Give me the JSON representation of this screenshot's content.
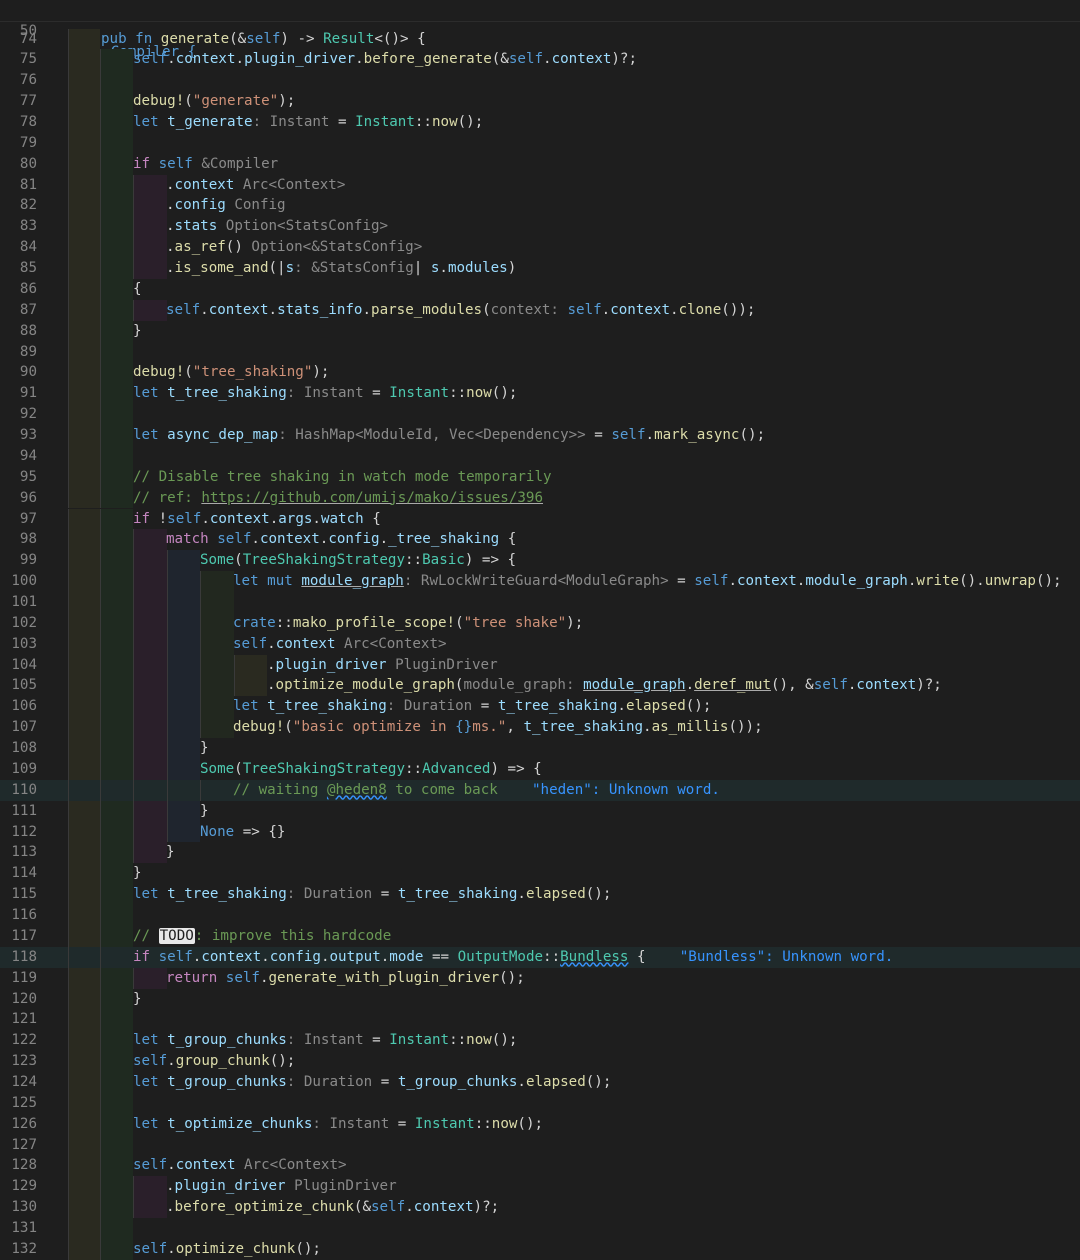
{
  "sticky_header": {
    "line_number": "50",
    "text": "impl Compiler {"
  },
  "lines": [
    {
      "n": "74",
      "g": 1,
      "tokens": [
        [
          "k",
          "pub "
        ],
        [
          "k",
          "fn "
        ],
        [
          "f",
          "generate"
        ],
        [
          "d",
          "(&"
        ],
        [
          "k",
          "self"
        ],
        [
          "d",
          ") -> "
        ],
        [
          "t",
          "Result"
        ],
        [
          "d",
          "<()> "
        ],
        [
          "d",
          "{"
        ]
      ]
    },
    {
      "n": "75",
      "g": 2,
      "tokens": [
        [
          "k",
          "self"
        ],
        [
          "d",
          "."
        ],
        [
          "v",
          "context"
        ],
        [
          "d",
          "."
        ],
        [
          "v",
          "plugin_driver"
        ],
        [
          "d",
          "."
        ],
        [
          "f",
          "before_generate"
        ],
        [
          "d",
          "(&"
        ],
        [
          "k",
          "self"
        ],
        [
          "d",
          "."
        ],
        [
          "v",
          "context"
        ],
        [
          "d",
          ")?;"
        ]
      ]
    },
    {
      "n": "76",
      "g": 2,
      "tokens": []
    },
    {
      "n": "77",
      "g": 2,
      "tokens": [
        [
          "f",
          "debug!"
        ],
        [
          "d",
          "("
        ],
        [
          "s",
          "\"generate\""
        ],
        [
          "d",
          ");"
        ]
      ]
    },
    {
      "n": "78",
      "g": 2,
      "tokens": [
        [
          "k",
          "let "
        ],
        [
          "v",
          "t_generate"
        ],
        [
          "h",
          ": Instant"
        ],
        [
          "d",
          " = "
        ],
        [
          "t",
          "Instant"
        ],
        [
          "d",
          "::"
        ],
        [
          "f",
          "now"
        ],
        [
          "d",
          "();"
        ]
      ]
    },
    {
      "n": "79",
      "g": 2,
      "tokens": []
    },
    {
      "n": "80",
      "g": 2,
      "tokens": [
        [
          "kc",
          "if "
        ],
        [
          "k",
          "self"
        ],
        [
          "h",
          " &Compiler"
        ]
      ]
    },
    {
      "n": "81",
      "g": 3,
      "tokens": [
        [
          "d",
          "."
        ],
        [
          "v",
          "context"
        ],
        [
          "h",
          " Arc<Context>"
        ]
      ]
    },
    {
      "n": "82",
      "g": 3,
      "tokens": [
        [
          "d",
          "."
        ],
        [
          "v",
          "config"
        ],
        [
          "h",
          " Config"
        ]
      ]
    },
    {
      "n": "83",
      "g": 3,
      "tokens": [
        [
          "d",
          "."
        ],
        [
          "v",
          "stats"
        ],
        [
          "h",
          " Option<StatsConfig>"
        ]
      ]
    },
    {
      "n": "84",
      "g": 3,
      "tokens": [
        [
          "d",
          "."
        ],
        [
          "f",
          "as_ref"
        ],
        [
          "d",
          "()"
        ],
        [
          "h",
          " Option<&StatsConfig>"
        ]
      ]
    },
    {
      "n": "85",
      "g": 3,
      "tokens": [
        [
          "d",
          "."
        ],
        [
          "f",
          "is_some_and"
        ],
        [
          "d",
          "(|"
        ],
        [
          "v",
          "s"
        ],
        [
          "h",
          ": &StatsConfig"
        ],
        [
          "d",
          "| "
        ],
        [
          "v",
          "s"
        ],
        [
          "d",
          "."
        ],
        [
          "v",
          "modules"
        ],
        [
          "d",
          ")"
        ]
      ]
    },
    {
      "n": "86",
      "g": 2,
      "tokens": [
        [
          "d",
          "{"
        ]
      ]
    },
    {
      "n": "87",
      "g": 3,
      "tokens": [
        [
          "k",
          "self"
        ],
        [
          "d",
          "."
        ],
        [
          "v",
          "context"
        ],
        [
          "d",
          "."
        ],
        [
          "v",
          "stats_info"
        ],
        [
          "d",
          "."
        ],
        [
          "f",
          "parse_modules"
        ],
        [
          "d",
          "("
        ],
        [
          "h",
          "context: "
        ],
        [
          "k",
          "self"
        ],
        [
          "d",
          "."
        ],
        [
          "v",
          "context"
        ],
        [
          "d",
          "."
        ],
        [
          "f",
          "clone"
        ],
        [
          "d",
          "());"
        ]
      ]
    },
    {
      "n": "88",
      "g": 2,
      "tokens": [
        [
          "d",
          "}"
        ]
      ]
    },
    {
      "n": "89",
      "g": 2,
      "tokens": []
    },
    {
      "n": "90",
      "g": 2,
      "tokens": [
        [
          "f",
          "debug!"
        ],
        [
          "d",
          "("
        ],
        [
          "s",
          "\"tree_shaking\""
        ],
        [
          "d",
          ");"
        ]
      ]
    },
    {
      "n": "91",
      "g": 2,
      "tokens": [
        [
          "k",
          "let "
        ],
        [
          "v",
          "t_tree_shaking"
        ],
        [
          "h",
          ": Instant"
        ],
        [
          "d",
          " = "
        ],
        [
          "t",
          "Instant"
        ],
        [
          "d",
          "::"
        ],
        [
          "f",
          "now"
        ],
        [
          "d",
          "();"
        ]
      ]
    },
    {
      "n": "92",
      "g": 2,
      "tokens": []
    },
    {
      "n": "93",
      "g": 2,
      "tokens": [
        [
          "k",
          "let "
        ],
        [
          "v",
          "async_dep_map"
        ],
        [
          "h",
          ": HashMap<ModuleId, Vec<Dependency>>"
        ],
        [
          "d",
          " = "
        ],
        [
          "k",
          "self"
        ],
        [
          "d",
          "."
        ],
        [
          "f",
          "mark_async"
        ],
        [
          "d",
          "();"
        ]
      ]
    },
    {
      "n": "94",
      "g": 2,
      "tokens": []
    },
    {
      "n": "95",
      "g": 2,
      "tokens": [
        [
          "c",
          "// Disable tree shaking in watch mode temporarily"
        ]
      ]
    },
    {
      "n": "96",
      "g": 2,
      "tokens": [
        [
          "c",
          "// ref: "
        ],
        [
          "cu",
          "https://github.com/umijs/mako/issues/396"
        ]
      ]
    },
    {
      "n": "97",
      "g": 2,
      "tokens": [
        [
          "kc",
          "if "
        ],
        [
          "d",
          "!"
        ],
        [
          "k",
          "self"
        ],
        [
          "d",
          "."
        ],
        [
          "v",
          "context"
        ],
        [
          "d",
          "."
        ],
        [
          "v",
          "args"
        ],
        [
          "d",
          "."
        ],
        [
          "v",
          "watch"
        ],
        [
          "d",
          " {"
        ]
      ]
    },
    {
      "n": "98",
      "g": 3,
      "tokens": [
        [
          "kc",
          "match "
        ],
        [
          "k",
          "self"
        ],
        [
          "d",
          "."
        ],
        [
          "v",
          "context"
        ],
        [
          "d",
          "."
        ],
        [
          "v",
          "config"
        ],
        [
          "d",
          "."
        ],
        [
          "v",
          "_tree_shaking"
        ],
        [
          "d",
          " {"
        ]
      ]
    },
    {
      "n": "99",
      "g": 4,
      "tokens": [
        [
          "t",
          "Some"
        ],
        [
          "d",
          "("
        ],
        [
          "t",
          "TreeShakingStrategy"
        ],
        [
          "d",
          "::"
        ],
        [
          "t",
          "Basic"
        ],
        [
          "d",
          ") => {"
        ]
      ]
    },
    {
      "n": "100",
      "g": 5,
      "tokens": [
        [
          "k",
          "let "
        ],
        [
          "k",
          "mut "
        ],
        [
          "vu",
          "module_graph"
        ],
        [
          "h",
          ": RwLockWriteGuard<ModuleGraph>"
        ],
        [
          "d",
          " = "
        ],
        [
          "k",
          "self"
        ],
        [
          "d",
          "."
        ],
        [
          "v",
          "context"
        ],
        [
          "d",
          "."
        ],
        [
          "v",
          "module_graph"
        ],
        [
          "d",
          "."
        ],
        [
          "f",
          "write"
        ],
        [
          "d",
          "()."
        ],
        [
          "f",
          "unwrap"
        ],
        [
          "d",
          "();"
        ]
      ]
    },
    {
      "n": "101",
      "g": 5,
      "tokens": []
    },
    {
      "n": "102",
      "g": 5,
      "tokens": [
        [
          "k",
          "crate"
        ],
        [
          "d",
          "::"
        ],
        [
          "f",
          "mako_profile_scope!"
        ],
        [
          "d",
          "("
        ],
        [
          "s",
          "\"tree shake\""
        ],
        [
          "d",
          ");"
        ]
      ]
    },
    {
      "n": "103",
      "g": 5,
      "tokens": [
        [
          "k",
          "self"
        ],
        [
          "d",
          "."
        ],
        [
          "v",
          "context"
        ],
        [
          "h",
          " Arc<Context>"
        ]
      ]
    },
    {
      "n": "104",
      "g": 6,
      "tokens": [
        [
          "d",
          "."
        ],
        [
          "v",
          "plugin_driver"
        ],
        [
          "h",
          " PluginDriver"
        ]
      ]
    },
    {
      "n": "105",
      "g": 6,
      "tokens": [
        [
          "d",
          "."
        ],
        [
          "f",
          "optimize_module_graph"
        ],
        [
          "d",
          "("
        ],
        [
          "h",
          "module_graph: "
        ],
        [
          "vu",
          "module_graph"
        ],
        [
          "d",
          "."
        ],
        [
          "fu",
          "deref_mut"
        ],
        [
          "d",
          "(), &"
        ],
        [
          "k",
          "self"
        ],
        [
          "d",
          "."
        ],
        [
          "v",
          "context"
        ],
        [
          "d",
          ")?;"
        ]
      ]
    },
    {
      "n": "106",
      "g": 5,
      "tokens": [
        [
          "k",
          "let "
        ],
        [
          "v",
          "t_tree_shaking"
        ],
        [
          "h",
          ": Duration"
        ],
        [
          "d",
          " = "
        ],
        [
          "v",
          "t_tree_shaking"
        ],
        [
          "d",
          "."
        ],
        [
          "f",
          "elapsed"
        ],
        [
          "d",
          "();"
        ]
      ]
    },
    {
      "n": "107",
      "g": 5,
      "tokens": [
        [
          "f",
          "debug!"
        ],
        [
          "d",
          "("
        ],
        [
          "s",
          "\"basic optimize in "
        ],
        [
          "k",
          "{}"
        ],
        [
          "s",
          "ms.\""
        ],
        [
          "d",
          ", "
        ],
        [
          "v",
          "t_tree_shaking"
        ],
        [
          "d",
          "."
        ],
        [
          "f",
          "as_millis"
        ],
        [
          "d",
          "());"
        ]
      ]
    },
    {
      "n": "108",
      "g": 4,
      "tokens": [
        [
          "d",
          "}"
        ]
      ]
    },
    {
      "n": "109",
      "g": 4,
      "tokens": [
        [
          "t",
          "Some"
        ],
        [
          "d",
          "("
        ],
        [
          "t",
          "TreeShakingStrategy"
        ],
        [
          "d",
          "::"
        ],
        [
          "t",
          "Advanced"
        ],
        [
          "d",
          ") => {"
        ]
      ]
    },
    {
      "n": "110",
      "g": 5,
      "hl": true,
      "tokens": [
        [
          "c",
          "// waiting "
        ],
        [
          "cw",
          "@heden8"
        ],
        [
          "c",
          " to come back    "
        ],
        [
          "diag",
          "\"heden\": Unknown word."
        ]
      ]
    },
    {
      "n": "111",
      "g": 4,
      "tokens": [
        [
          "d",
          "}"
        ]
      ]
    },
    {
      "n": "112",
      "g": 4,
      "tokens": [
        [
          "k",
          "None"
        ],
        [
          "d",
          " => {}"
        ]
      ]
    },
    {
      "n": "113",
      "g": 3,
      "tokens": [
        [
          "d",
          "}"
        ]
      ]
    },
    {
      "n": "114",
      "g": 2,
      "tokens": [
        [
          "d",
          "}"
        ]
      ]
    },
    {
      "n": "115",
      "g": 2,
      "tokens": [
        [
          "k",
          "let "
        ],
        [
          "v",
          "t_tree_shaking"
        ],
        [
          "h",
          ": Duration"
        ],
        [
          "d",
          " = "
        ],
        [
          "v",
          "t_tree_shaking"
        ],
        [
          "d",
          "."
        ],
        [
          "f",
          "elapsed"
        ],
        [
          "d",
          "();"
        ]
      ]
    },
    {
      "n": "116",
      "g": 2,
      "tokens": []
    },
    {
      "n": "117",
      "g": 2,
      "tokens": [
        [
          "c",
          "// "
        ],
        [
          "todo",
          "TODO"
        ],
        [
          "c",
          ": improve this hardcode"
        ]
      ]
    },
    {
      "n": "118",
      "g": 2,
      "hl": true,
      "tokens": [
        [
          "kc",
          "if "
        ],
        [
          "k",
          "self"
        ],
        [
          "d",
          "."
        ],
        [
          "v",
          "context"
        ],
        [
          "d",
          "."
        ],
        [
          "v",
          "config"
        ],
        [
          "d",
          "."
        ],
        [
          "v",
          "output"
        ],
        [
          "d",
          "."
        ],
        [
          "v",
          "mode"
        ],
        [
          "d",
          " == "
        ],
        [
          "t",
          "OutputMode"
        ],
        [
          "d",
          "::"
        ],
        [
          "tw",
          "Bundless"
        ],
        [
          "d",
          " {    "
        ],
        [
          "diag",
          "\"Bundless\": Unknown word."
        ]
      ]
    },
    {
      "n": "119",
      "g": 3,
      "tokens": [
        [
          "kc",
          "return "
        ],
        [
          "k",
          "self"
        ],
        [
          "d",
          "."
        ],
        [
          "f",
          "generate_with_plugin_driver"
        ],
        [
          "d",
          "();"
        ]
      ]
    },
    {
      "n": "120",
      "g": 2,
      "tokens": [
        [
          "d",
          "}"
        ]
      ]
    },
    {
      "n": "121",
      "g": 2,
      "tokens": []
    },
    {
      "n": "122",
      "g": 2,
      "tokens": [
        [
          "k",
          "let "
        ],
        [
          "v",
          "t_group_chunks"
        ],
        [
          "h",
          ": Instant"
        ],
        [
          "d",
          " = "
        ],
        [
          "t",
          "Instant"
        ],
        [
          "d",
          "::"
        ],
        [
          "f",
          "now"
        ],
        [
          "d",
          "();"
        ]
      ]
    },
    {
      "n": "123",
      "g": 2,
      "tokens": [
        [
          "k",
          "self"
        ],
        [
          "d",
          "."
        ],
        [
          "f",
          "group_chunk"
        ],
        [
          "d",
          "();"
        ]
      ]
    },
    {
      "n": "124",
      "g": 2,
      "tokens": [
        [
          "k",
          "let "
        ],
        [
          "v",
          "t_group_chunks"
        ],
        [
          "h",
          ": Duration"
        ],
        [
          "d",
          " = "
        ],
        [
          "v",
          "t_group_chunks"
        ],
        [
          "d",
          "."
        ],
        [
          "f",
          "elapsed"
        ],
        [
          "d",
          "();"
        ]
      ]
    },
    {
      "n": "125",
      "g": 2,
      "tokens": []
    },
    {
      "n": "126",
      "g": 2,
      "tokens": [
        [
          "k",
          "let "
        ],
        [
          "v",
          "t_optimize_chunks"
        ],
        [
          "h",
          ": Instant"
        ],
        [
          "d",
          " = "
        ],
        [
          "t",
          "Instant"
        ],
        [
          "d",
          "::"
        ],
        [
          "f",
          "now"
        ],
        [
          "d",
          "();"
        ]
      ]
    },
    {
      "n": "127",
      "g": 2,
      "tokens": []
    },
    {
      "n": "128",
      "g": 2,
      "tokens": [
        [
          "k",
          "self"
        ],
        [
          "d",
          "."
        ],
        [
          "v",
          "context"
        ],
        [
          "h",
          " Arc<Context>"
        ]
      ]
    },
    {
      "n": "129",
      "g": 3,
      "tokens": [
        [
          "d",
          "."
        ],
        [
          "v",
          "plugin_driver"
        ],
        [
          "h",
          " PluginDriver"
        ]
      ]
    },
    {
      "n": "130",
      "g": 3,
      "tokens": [
        [
          "d",
          "."
        ],
        [
          "f",
          "before_optimize_chunk"
        ],
        [
          "d",
          "(&"
        ],
        [
          "k",
          "self"
        ],
        [
          "d",
          "."
        ],
        [
          "v",
          "context"
        ],
        [
          "d",
          ")?;"
        ]
      ]
    },
    {
      "n": "131",
      "g": 2,
      "tokens": []
    },
    {
      "n": "132",
      "g": 2,
      "tokens": [
        [
          "k",
          "self"
        ],
        [
          "d",
          "."
        ],
        [
          "f",
          "optimize_chunk"
        ],
        [
          "d",
          "();"
        ]
      ]
    }
  ]
}
